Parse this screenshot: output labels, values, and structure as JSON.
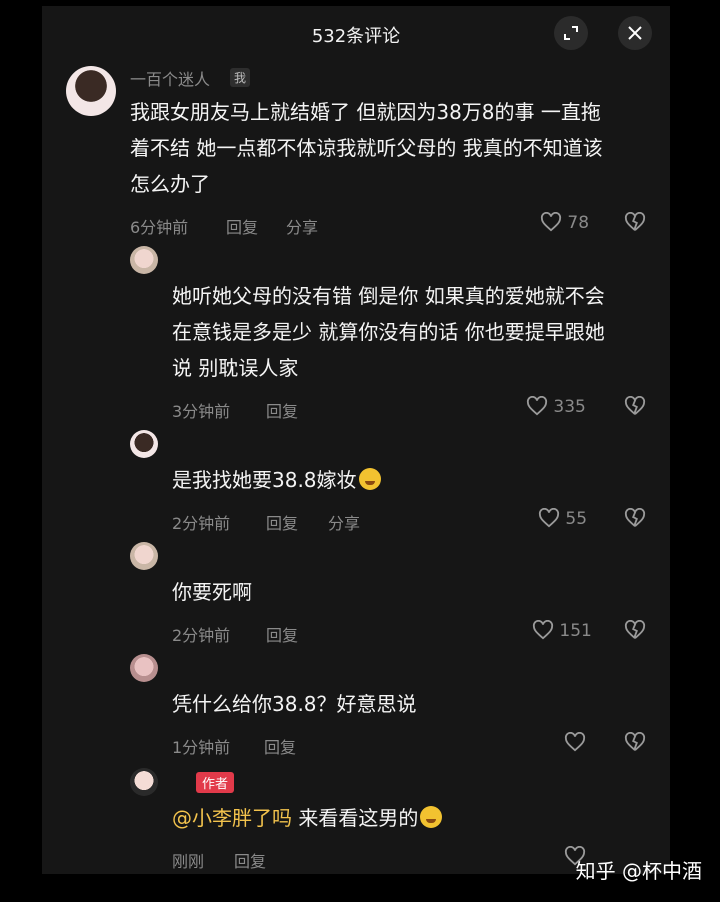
{
  "header": {
    "title": "532条评论",
    "expand_icon": "expand-icon",
    "close_icon": "close-icon"
  },
  "comments": [
    {
      "author": "一百个迷人",
      "me_tag": "我",
      "text_lines": [
        "我跟女朋友马上就结婚了 但就因为38万8的事 一直拖",
        "着不结 她一点都不体谅我就听父母的 我真的不知道该",
        "怎么办了"
      ],
      "time": "6分钟前",
      "reply": "回复",
      "share": "分享",
      "likes": "78"
    },
    {
      "text_lines": [
        "她听她父母的没有错 倒是你 如果真的爱她就不会",
        "在意钱是多是少 就算你没有的话 你也要提早跟她",
        "说 别耽误人家"
      ],
      "time": "3分钟前",
      "reply": "回复",
      "likes": "335"
    },
    {
      "text": "是我找她要38.8嫁妆",
      "time": "2分钟前",
      "reply": "回复",
      "share": "分享",
      "likes": "55"
    },
    {
      "text": "你要死啊",
      "time": "2分钟前",
      "reply": "回复",
      "likes": "151"
    },
    {
      "text": "凭什么给你38.8？好意思说",
      "time": "1分钟前",
      "reply": "回复",
      "likes": ""
    },
    {
      "author_tag": "作者",
      "mention": "@小李胖了吗",
      "text": " 来看看这男的",
      "time": "刚刚",
      "reply": "回复",
      "likes": ""
    }
  ],
  "watermark": "知乎 @杯中酒",
  "colors": {
    "panel": "#161616",
    "author_tag": "#e23a4a",
    "mention": "#f3c34d"
  }
}
